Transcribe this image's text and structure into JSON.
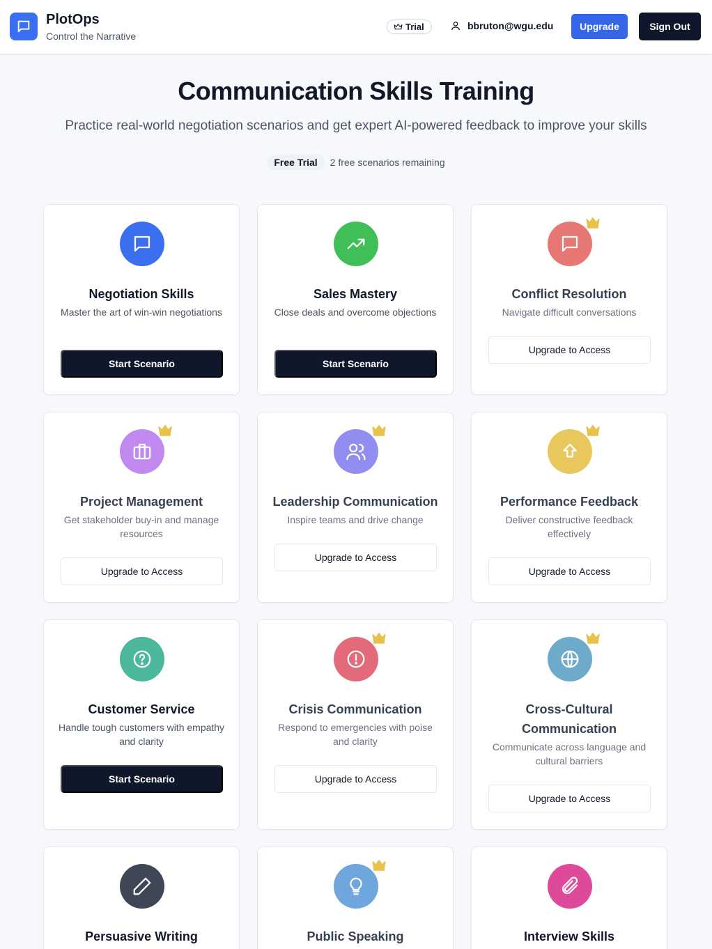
{
  "header": {
    "brand_name": "PlotOps",
    "brand_tagline": "Control the Narrative",
    "trial_label": "Trial",
    "user_email": "bbruton@wgu.edu",
    "upgrade_label": "Upgrade",
    "signout_label": "Sign Out"
  },
  "hero": {
    "title": "Communication Skills Training",
    "subtitle": "Practice real-world negotiation scenarios and get expert AI-powered feedback to improve your skills",
    "trial_badge": "Free Trial",
    "trial_note": "2 free scenarios remaining"
  },
  "colors": {
    "accent": "#3566e8",
    "dark": "#0f172a",
    "crown": "#e8c14a"
  },
  "cards": [
    {
      "title": "Negotiation Skills",
      "desc": "Master the art of win-win negotiations",
      "button": "Start Scenario",
      "icon": "message-icon",
      "color": "#3b6ff0",
      "locked": false
    },
    {
      "title": "Sales Mastery",
      "desc": "Close deals and overcome objections",
      "button": "Start Scenario",
      "icon": "trending-up-icon",
      "color": "#3fbf55",
      "locked": false
    },
    {
      "title": "Conflict Resolution",
      "desc": "Navigate difficult conversations",
      "button": "Upgrade to Access",
      "icon": "message-icon",
      "color": "#e25a54",
      "locked": true
    },
    {
      "title": "Project Management",
      "desc": "Get stakeholder buy-in and manage resources",
      "button": "Upgrade to Access",
      "icon": "briefcase-icon",
      "color": "#b570ee",
      "locked": true
    },
    {
      "title": "Leadership Communication",
      "desc": "Inspire teams and drive change",
      "button": "Upgrade to Access",
      "icon": "users-icon",
      "color": "#7b76ee",
      "locked": true
    },
    {
      "title": "Performance Feedback",
      "desc": "Deliver constructive feedback effectively",
      "button": "Upgrade to Access",
      "icon": "arrow-up-icon",
      "color": "#e3bc3a",
      "locked": true
    },
    {
      "title": "Customer Service",
      "desc": "Handle tough customers with empathy and clarity",
      "button": "Start Scenario",
      "icon": "help-circle-icon",
      "color": "#4bb89c",
      "locked": false
    },
    {
      "title": "Crisis Communication",
      "desc": "Respond to emergencies with poise and clarity",
      "button": "Upgrade to Access",
      "icon": "alert-circle-icon",
      "color": "#de4a5f",
      "locked": true
    },
    {
      "title": "Cross-Cultural Communication",
      "desc": "Communicate across language and cultural barriers",
      "button": "Upgrade to Access",
      "icon": "globe-icon",
      "color": "#4f98bf",
      "locked": true
    },
    {
      "title": "Persuasive Writing",
      "desc": "",
      "button": "",
      "icon": "pen-icon",
      "color": "#3f4756",
      "locked": false
    },
    {
      "title": "Public Speaking",
      "desc": "",
      "button": "",
      "icon": "lightbulb-icon",
      "color": "#4f93d6",
      "locked": true
    },
    {
      "title": "Interview Skills",
      "desc": "",
      "button": "",
      "icon": "paperclip-icon",
      "color": "#de4a9a",
      "locked": false
    }
  ]
}
